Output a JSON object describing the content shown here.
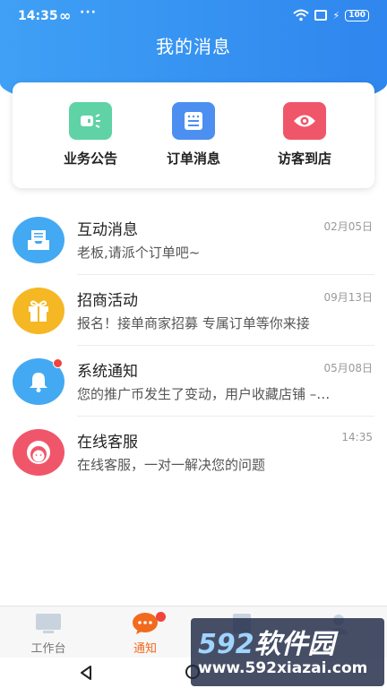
{
  "status_bar": {
    "time": "14:35",
    "infinity": "∞",
    "dots": "···",
    "bolt": "⚡",
    "battery": "100"
  },
  "header": {
    "title": "我的消息"
  },
  "quick_actions": [
    {
      "label": "业务公告",
      "icon": "megaphone-icon",
      "color": "#5fd3a5"
    },
    {
      "label": "订单消息",
      "icon": "order-list-icon",
      "color": "#4c8ff0"
    },
    {
      "label": "访客到店",
      "icon": "eye-icon",
      "color": "#f0566a"
    }
  ],
  "messages": [
    {
      "title": "互动消息",
      "preview": "老板,请派个订单吧~",
      "time": "02月05日",
      "icon": "inbox-icon",
      "color": "#43a9f2",
      "unread": false
    },
    {
      "title": "招商活动",
      "preview": "报名！接单商家招募 专属订单等你来接",
      "time": "09月13日",
      "icon": "gift-icon",
      "color": "#f5b723",
      "unread": false
    },
    {
      "title": "系统通知",
      "preview": "您的推广币发生了变动，用户收藏店铺 –…",
      "time": "05月08日",
      "icon": "bell-icon",
      "color": "#43a9f2",
      "unread": true
    },
    {
      "title": "在线客服",
      "preview": "在线客服，一对一解决您的问题",
      "time": "14:35",
      "icon": "agent-icon",
      "color": "#f0566a",
      "unread": false
    }
  ],
  "tabs": [
    {
      "label": "工作台",
      "icon": "monitor-icon",
      "active": false
    },
    {
      "label": "通知",
      "icon": "chat-bubble-icon",
      "active": true,
      "badge": true
    },
    {
      "label": "",
      "icon": "document-icon",
      "active": false
    },
    {
      "label": "",
      "icon": "user-icon",
      "active": false
    }
  ],
  "colors": {
    "header": "#3596f0",
    "active_tab": "#f26a1e",
    "badge": "#f0443c"
  },
  "watermark": {
    "brand_num": "592",
    "brand_text": "软件园",
    "url": "www.592xiazai.com"
  }
}
